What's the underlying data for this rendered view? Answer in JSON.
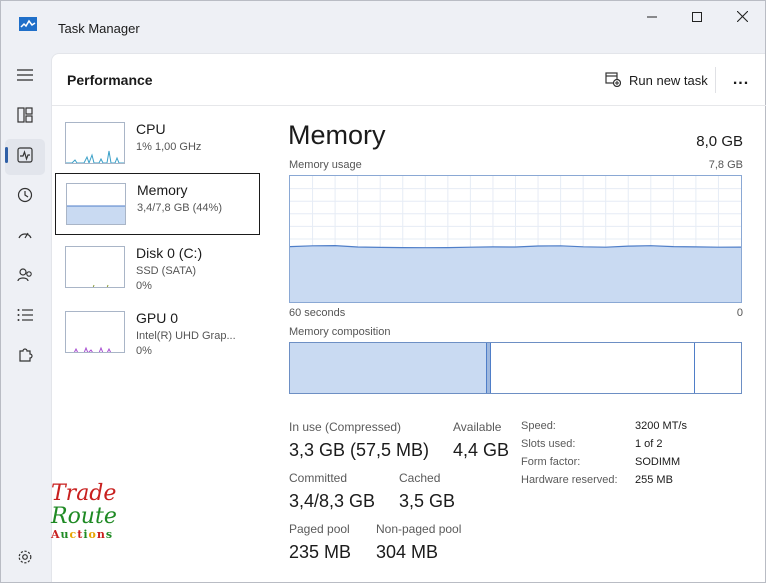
{
  "window": {
    "title": "Task Manager",
    "icon": "task-manager-icon",
    "controls": [
      "minimize-icon",
      "maximize-icon",
      "close-icon"
    ]
  },
  "nav": {
    "items": [
      {
        "name": "hamburger-menu",
        "icon": "menu-icon"
      },
      {
        "name": "processes",
        "icon": "grid-icon"
      },
      {
        "name": "performance",
        "icon": "pulse-icon",
        "active": true
      },
      {
        "name": "app-history",
        "icon": "history-icon"
      },
      {
        "name": "startup-apps",
        "icon": "gauge-icon"
      },
      {
        "name": "users",
        "icon": "users-icon"
      },
      {
        "name": "details",
        "icon": "list-icon"
      },
      {
        "name": "services",
        "icon": "puzzle-icon"
      },
      {
        "name": "settings",
        "icon": "gear-icon"
      }
    ]
  },
  "header": {
    "page_title": "Performance",
    "run_new_task_label": "Run new task",
    "more_label": "..."
  },
  "resources": [
    {
      "name": "CPU",
      "sub1": "1% 1,00 GHz",
      "sub2": ""
    },
    {
      "name": "Memory",
      "sub1": "3,4/7,8 GB (44%)",
      "sub2": "",
      "selected": true
    },
    {
      "name": "Disk 0 (C:)",
      "sub1": "SSD (SATA)",
      "sub2": "0%"
    },
    {
      "name": "GPU 0",
      "sub1": "Intel(R) UHD Grap...",
      "sub2": "0%"
    }
  ],
  "memory": {
    "title": "Memory",
    "total": "8,0 GB",
    "usage_label": "Memory usage",
    "usage_max": "7,8 GB",
    "graph_left_label": "60 seconds",
    "graph_right_label": "0",
    "usage_fraction": 0.44,
    "composition_label": "Memory composition",
    "composition": {
      "in_use_fraction": 0.435,
      "modified_fraction": 0.008,
      "standby_fraction": 0.452,
      "free_fraction": 0.105
    }
  },
  "stats": {
    "in_use_label": "In use (Compressed)",
    "in_use_value": "3,3 GB (57,5 MB)",
    "available_label": "Available",
    "available_value": "4,4 GB",
    "committed_label": "Committed",
    "committed_value": "3,4/8,3 GB",
    "cached_label": "Cached",
    "cached_value": "3,5 GB",
    "paged_label": "Paged pool",
    "paged_value": "235 MB",
    "nonpaged_label": "Non-paged pool",
    "nonpaged_value": "304 MB"
  },
  "specs": {
    "speed_label": "Speed:",
    "speed_value": "3200 MT/s",
    "slots_label": "Slots used:",
    "slots_value": "1 of 2",
    "form_label": "Form factor:",
    "form_value": "SODIMM",
    "reserved_label": "Hardware reserved:",
    "reserved_value": "255 MB"
  },
  "watermark": {
    "line1": "Trade",
    "line2": "Route",
    "line3": "Auctions",
    "colors": [
      "#c8201f",
      "#1f8a24",
      "#e8a400"
    ]
  },
  "colors": {
    "accent": "#2f5fa6",
    "mem_fill": "#c9daf2",
    "mem_line": "#4f7ec8",
    "cpu_line": "#3aa0c8",
    "gpu_line": "#a84fd1"
  }
}
